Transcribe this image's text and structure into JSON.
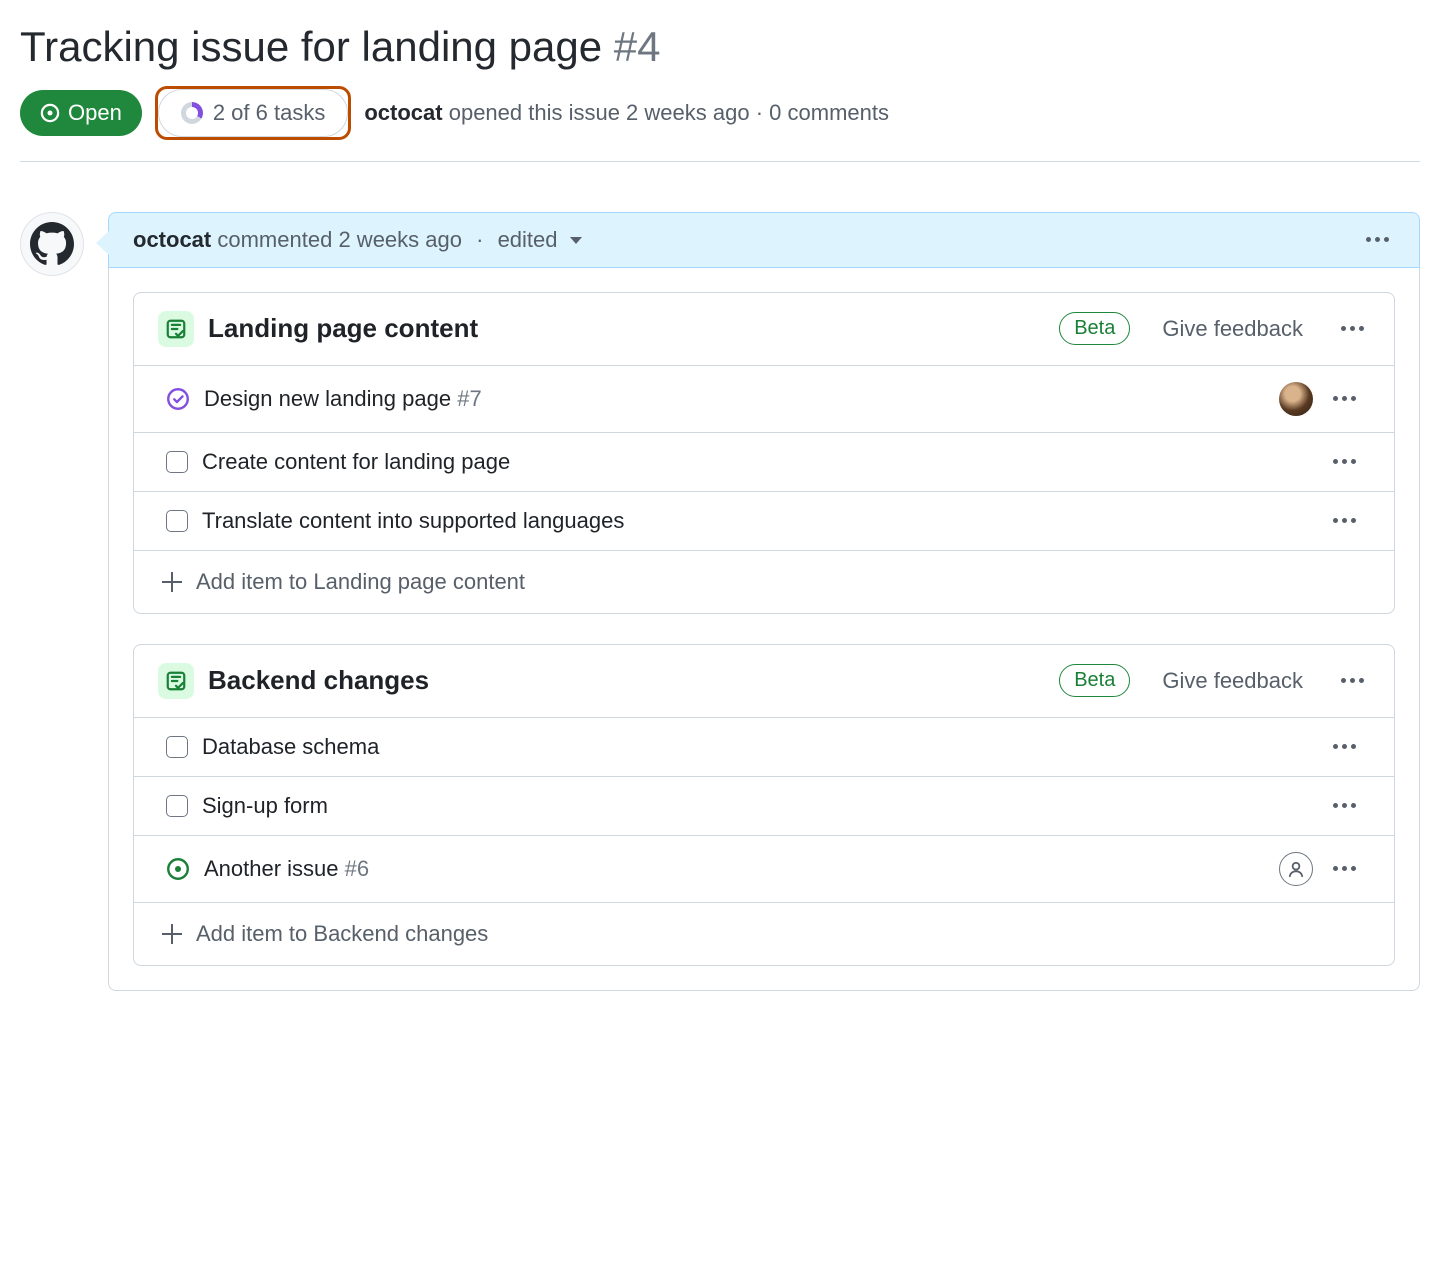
{
  "header": {
    "title": "Tracking issue for landing page",
    "issue_number": "#4"
  },
  "status": {
    "label": "Open"
  },
  "task_progress": {
    "label": "2 of 6 tasks"
  },
  "meta": {
    "author": "octocat",
    "opened": "opened this issue 2 weeks ago",
    "comments": "0 comments"
  },
  "comment": {
    "author": "octocat",
    "action": "commented",
    "time": "2 weeks ago",
    "edited": "edited"
  },
  "tasklists": [
    {
      "title": "Landing page content",
      "beta": "Beta",
      "feedback": "Give feedback",
      "items": [
        {
          "type": "closed",
          "label": "Design new landing page",
          "ref": "#7",
          "assignee": "user"
        },
        {
          "type": "checkbox",
          "label": "Create content for landing page"
        },
        {
          "type": "checkbox",
          "label": "Translate content into supported languages"
        }
      ],
      "add_label": "Add item to Landing page content"
    },
    {
      "title": "Backend changes",
      "beta": "Beta",
      "feedback": "Give feedback",
      "items": [
        {
          "type": "checkbox",
          "label": "Database schema"
        },
        {
          "type": "checkbox",
          "label": "Sign-up form"
        },
        {
          "type": "open",
          "label": "Another issue",
          "ref": "#6",
          "assignee": "placeholder"
        }
      ],
      "add_label": "Add item to Backend changes"
    }
  ]
}
